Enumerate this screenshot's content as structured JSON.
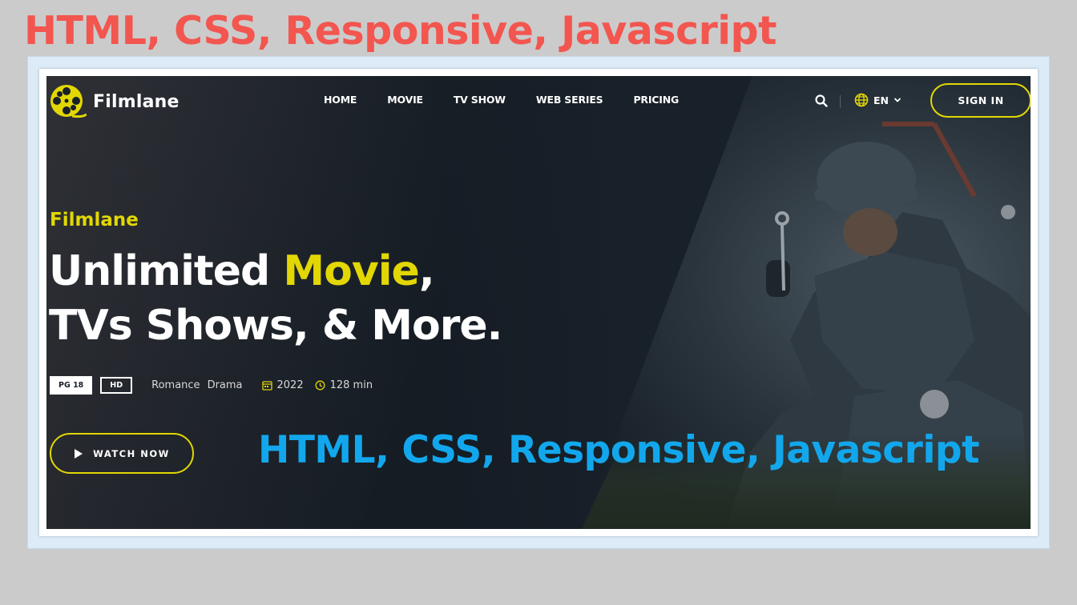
{
  "page_title": "HTML, CSS, Responsive, Javascript",
  "brand": {
    "name": "Filmlane",
    "accent": "#e2d703"
  },
  "nav": {
    "items": [
      {
        "label": "HOME"
      },
      {
        "label": "MOVIE"
      },
      {
        "label": "TV SHOW"
      },
      {
        "label": "WEB SERIES"
      },
      {
        "label": "PRICING"
      }
    ],
    "search_icon": "search-icon",
    "language": "EN",
    "signin_label": "SIGN IN"
  },
  "hero": {
    "subtitle": "Filmlane",
    "headline_part1": "Unlimited ",
    "headline_highlight": "Movie",
    "headline_part2": ",",
    "headline_line2": "TVs Shows, & More.",
    "badges": {
      "rating": "PG 18",
      "quality": "HD"
    },
    "genres": [
      "Romance",
      "Drama"
    ],
    "year": "2022",
    "duration": "128 min",
    "watch_label": "WATCH NOW"
  },
  "overlay_title": "HTML, CSS, Responsive, Javascript",
  "colors": {
    "title_red": "#f2564f",
    "overlay_blue": "#12a7ec",
    "hero_bg": "#182029"
  }
}
